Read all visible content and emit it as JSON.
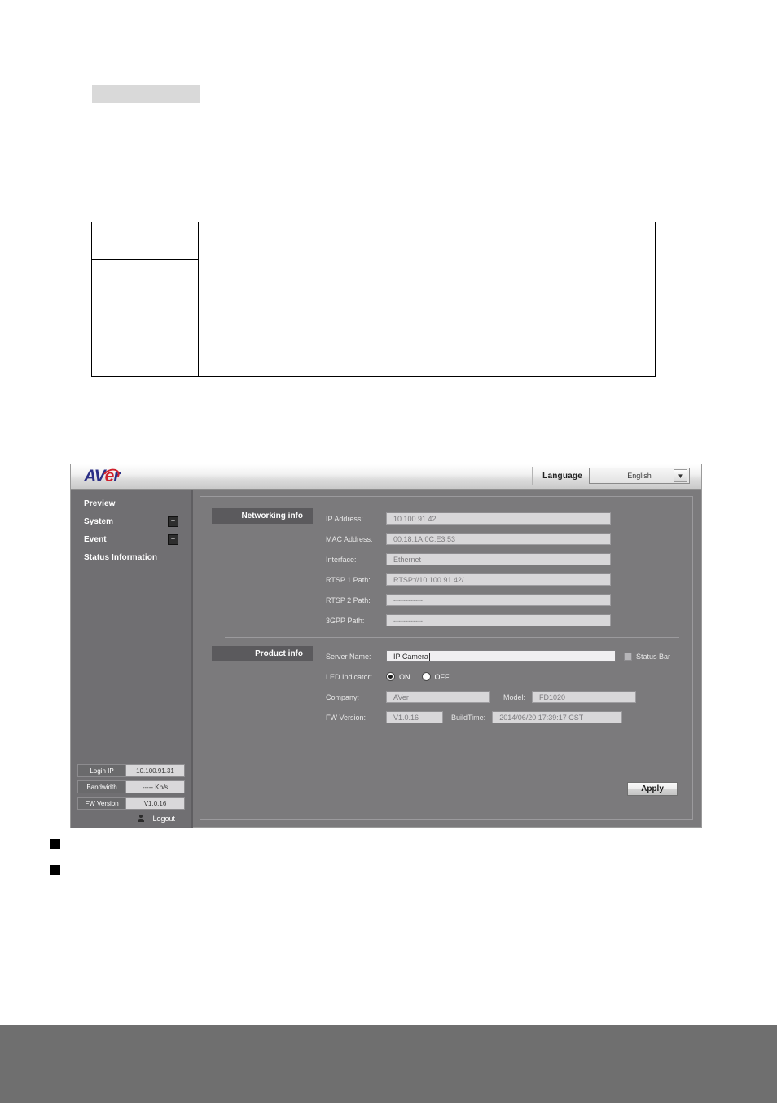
{
  "document": {
    "highlight_block": "",
    "table": {
      "rows": [
        {
          "label": "",
          "value": ""
        },
        {
          "label": "",
          "value": ""
        },
        {
          "label": "",
          "value": ""
        },
        {
          "label": "",
          "value": ""
        }
      ]
    },
    "bullets": [
      {
        "text": ""
      },
      {
        "text": ""
      }
    ]
  },
  "app": {
    "brand": {
      "part1": "AV",
      "part2": "e",
      "part3": "r"
    },
    "language": {
      "label": "Language",
      "selected": "English",
      "caret": "chevron-down-icon",
      "options": [
        "English"
      ]
    },
    "sidebar": {
      "items": [
        {
          "label": "Preview",
          "expandable": false,
          "expand_glyph": ""
        },
        {
          "label": "System",
          "expandable": true,
          "expand_glyph": "+"
        },
        {
          "label": "Event",
          "expandable": true,
          "expand_glyph": "+"
        },
        {
          "label": "Status Information",
          "expandable": false,
          "expand_glyph": ""
        }
      ],
      "status": [
        {
          "key": "Login IP",
          "value": "10.100.91.31"
        },
        {
          "key": "Bandwidth",
          "value": "----- Kb/s"
        },
        {
          "key": "FW Version",
          "value": "V1.0.16"
        }
      ],
      "logout": {
        "icon": "user-icon",
        "label": "Logout"
      }
    },
    "sections": {
      "networking": {
        "title": "Networking info",
        "fields": [
          {
            "label": "IP Address:",
            "value": "10.100.91.42"
          },
          {
            "label": "MAC Address:",
            "value": "00:18:1A:0C:E3:53"
          },
          {
            "label": "Interface:",
            "value": "Ethernet"
          },
          {
            "label": "RTSP 1 Path:",
            "value": "RTSP://10.100.91.42/"
          },
          {
            "label": "RTSP 2 Path:",
            "value": "------------"
          },
          {
            "label": "3GPP Path:",
            "value": "------------"
          }
        ]
      },
      "product": {
        "title": "Product info",
        "server_name": {
          "label": "Server Name:",
          "value": "IP Camera"
        },
        "status_bar": {
          "label": "Status Bar",
          "checked": false
        },
        "led": {
          "label": "LED Indicator:",
          "on_label": "ON",
          "off_label": "OFF",
          "selected": "ON"
        },
        "company": {
          "label": "Company:",
          "value": "AVer"
        },
        "model": {
          "label": "Model:",
          "value": "FD1020"
        },
        "fw_version": {
          "label": "FW Version:",
          "value": "V1.0.16"
        },
        "build_time": {
          "label": "BuildTime:",
          "value": "2014/06/20 17:39:17 CST"
        }
      }
    },
    "apply_button": "Apply"
  }
}
